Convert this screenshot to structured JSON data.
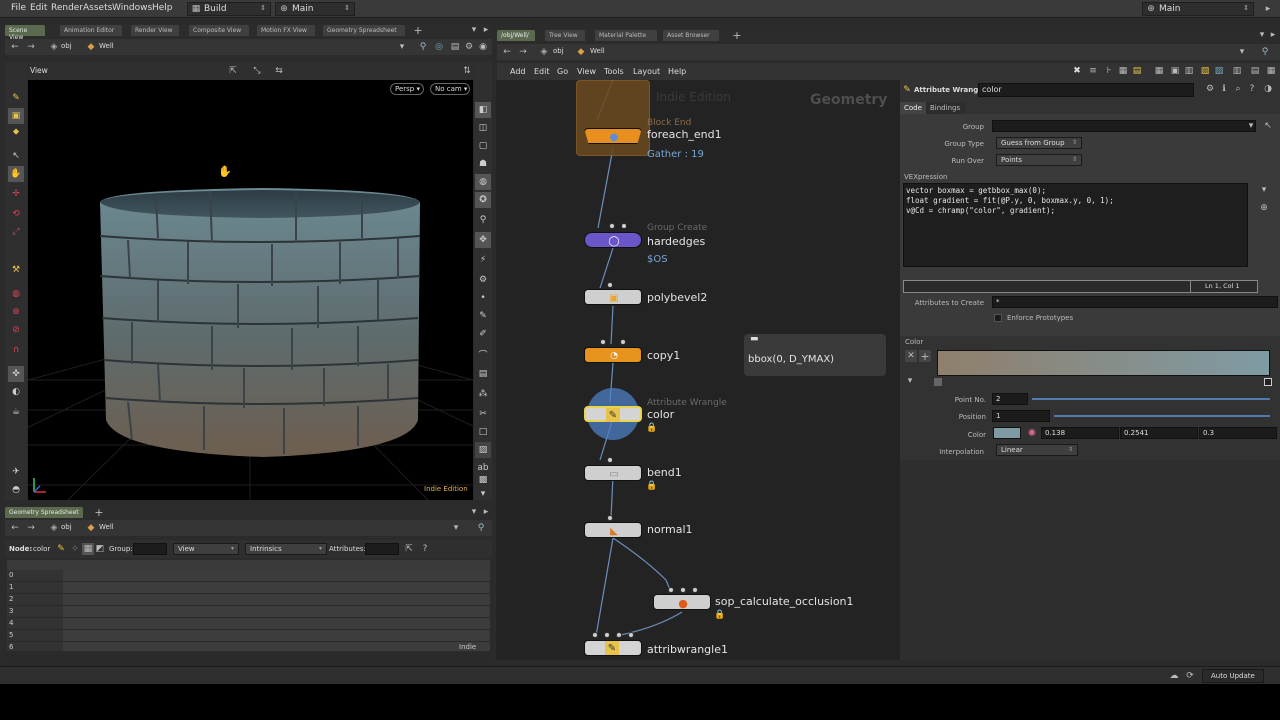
{
  "menu": [
    "File",
    "Edit",
    "Render",
    "Assets",
    "Windows",
    "Help"
  ],
  "desktop": "Build",
  "context": "Main",
  "right_context": "Main",
  "left_tabs": [
    "Scene View",
    "Animation Editor",
    "Render View",
    "Composite View",
    "Motion FX View",
    "Geometry Spreadsheet"
  ],
  "right_tabs": [
    "/obj/Well/",
    "Tree View",
    "Material Palette",
    "Asset Browser"
  ],
  "path": {
    "root": "obj",
    "node": "Well"
  },
  "viewport": {
    "label": "View",
    "persp": "Persp",
    "cam": "No cam",
    "edition": "Indie Edition"
  },
  "spreadsheet": {
    "tab": "Geometry Spreadsheet",
    "node_label": "Node:",
    "node_value": "color",
    "group_label": "Group:",
    "view_label": "View",
    "intrinsics_label": "Intrinsics",
    "attributes_label": "Attributes:",
    "rows": [
      "0",
      "1",
      "2",
      "3",
      "4",
      "5",
      "6"
    ],
    "footer": "Indie"
  },
  "network": {
    "menu": [
      "Add",
      "Edit",
      "Go",
      "View",
      "Tools",
      "Layout",
      "Help"
    ],
    "watermark": "Indie Edition",
    "context_label": "Geometry",
    "nodes": {
      "foreach_end": {
        "type": "Block End",
        "name": "foreach_end1",
        "sub": "Gather : 19"
      },
      "group": {
        "type": "Group Create",
        "name": "hardedges",
        "sub": "$OS"
      },
      "polybevel": {
        "name": "polybevel2"
      },
      "copy": {
        "name": "copy1"
      },
      "color": {
        "type": "Attribute Wrangle",
        "name": "color"
      },
      "bend": {
        "name": "bend1"
      },
      "normal": {
        "name": "normal1"
      },
      "occl": {
        "name": "sop_calculate_occlusion1"
      },
      "attrib": {
        "name": "attribwrangle1"
      }
    },
    "note": {
      "text": "bbox(0, D_YMAX)"
    }
  },
  "params": {
    "title": "Attribute Wrangle",
    "node": "color",
    "tabs": [
      "Code",
      "Bindings"
    ],
    "group_label": "Group",
    "group_value": "",
    "group_type_label": "Group Type",
    "group_type_value": "Guess from Group",
    "run_over_label": "Run Over",
    "run_over_value": "Points",
    "vex_label": "VEXpression",
    "vex_lines": [
      "vector boxmax = getbbox_max(0);",
      "float gradient = fit(@P.y, 0, boxmax.y, 0, 1);",
      "v@Cd = chramp(\"color\", gradient);"
    ],
    "cursor": "Ln 1, Col 1",
    "attr_create_label": "Attributes to Create",
    "attr_create_value": "*",
    "enforce_label": "Enforce Prototypes",
    "color_section": "Color",
    "point_no_label": "Point No.",
    "point_no_value": "2",
    "position_label": "Position",
    "position_value": "1",
    "color_label": "Color",
    "color_r": "0.138",
    "color_g": "0.2541",
    "color_b": "0.3",
    "swatch": "#7f9ba4",
    "interp_label": "Interpolation",
    "interp_value": "Linear"
  },
  "status": {
    "auto_update": "Auto Update"
  }
}
